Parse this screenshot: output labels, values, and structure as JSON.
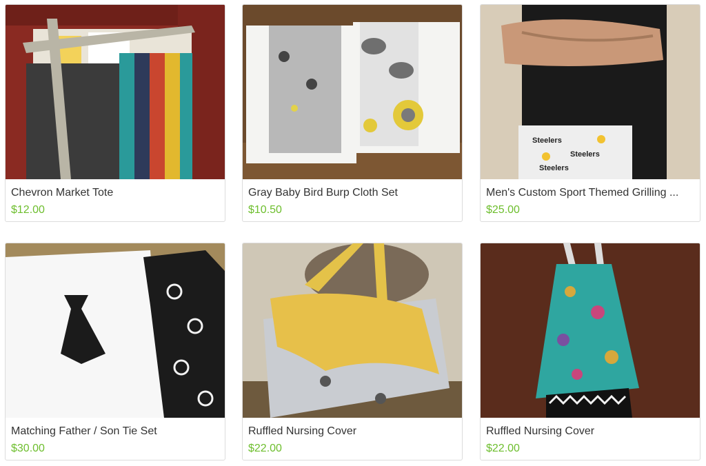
{
  "theme": {
    "price_color": "#6dbe2d",
    "title_color": "#333333"
  },
  "products": [
    {
      "title": "Chevron Market Tote",
      "price": "$12.00",
      "image": "chevron-tote-photo"
    },
    {
      "title": "Gray Baby Bird Burp Cloth Set",
      "price": "$10.50",
      "image": "burp-cloth-photo"
    },
    {
      "title": "Men's Custom Sport Themed Grilling ...",
      "price": "$25.00",
      "image": "grilling-apron-photo"
    },
    {
      "title": "Matching Father / Son Tie Set",
      "price": "$30.00",
      "image": "tie-set-photo"
    },
    {
      "title": "Ruffled Nursing Cover",
      "price": "$22.00",
      "image": "nursing-cover-yellow-photo"
    },
    {
      "title": "Ruffled Nursing Cover",
      "price": "$22.00",
      "image": "nursing-cover-teal-photo"
    }
  ]
}
